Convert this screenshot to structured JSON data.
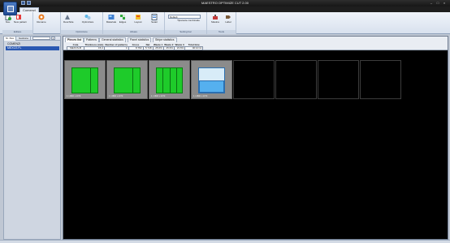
{
  "window": {
    "title": "MAESTRO OPTIMIZE CUT 2.00"
  },
  "ribbon": {
    "active_tab": "Comenzi",
    "groups": [
      {
        "label": "Editare"
      },
      {
        "label": "Optimizare"
      },
      {
        "label": "Afisare"
      },
      {
        "label": "Setting bar"
      },
      {
        "label": "Tools"
      }
    ],
    "buttons": {
      "new": "Nou",
      "new_pattern": "New pattern",
      "rename": "Rename",
      "open": "Deschide",
      "optimize": "Optimizare",
      "material": "Materiale",
      "edges": "Edges",
      "layout": "Layout",
      "settings": "Setari",
      "combine": "Tipareste combinatie",
      "machine": "Masina",
      "label": "Label"
    },
    "combo_value": "Default"
  },
  "left_panel": {
    "tabs": [
      "Nr. files",
      "Gestiune",
      "Lista"
    ],
    "selector_value": "",
    "plus_label": "+",
    "tree": [
      {
        "label": "COMENZI",
        "selected": false
      },
      {
        "label": "MEXCS FL",
        "selected": true
      }
    ]
  },
  "main": {
    "tabs": [
      {
        "label": "Pieces list",
        "active": true
      },
      {
        "label": "Patterns",
        "active": false
      },
      {
        "label": "General statistics",
        "active": false
      },
      {
        "label": "Panel statistics",
        "active": false
      },
      {
        "label": "Stripe statistics",
        "active": false
      }
    ],
    "stats": {
      "headers": [
        "Cota",
        "Thickness (mm)",
        "Number of patterns",
        "Gross",
        "Net",
        "Waste 1",
        "Waste 2",
        "Waste 3",
        "Total time"
      ],
      "row": [
        "MEXCS-B",
        "15,4",
        "4",
        "8.782",
        "5.748",
        "25.6%",
        "25.6%",
        "23.6%",
        "00:10:11"
      ]
    },
    "patterns": [
      {
        "caption": "1 / 2800 x 2070",
        "type": "full",
        "cuts": [
          0.72
        ]
      },
      {
        "caption": "1 / 2800 x 2070",
        "type": "full",
        "cuts": [
          0.72
        ]
      },
      {
        "caption": "1 / 2800 x 2070",
        "type": "full",
        "cuts": [
          0.24,
          0.5,
          0.76
        ]
      },
      {
        "caption": "1 / 2800 x 2070",
        "type": "partial"
      }
    ],
    "empty_slots": 4
  },
  "colors": {
    "panel_green": "#1ecb2a",
    "panel_blue": "#55b0ef",
    "canvas_black": "#000000"
  }
}
